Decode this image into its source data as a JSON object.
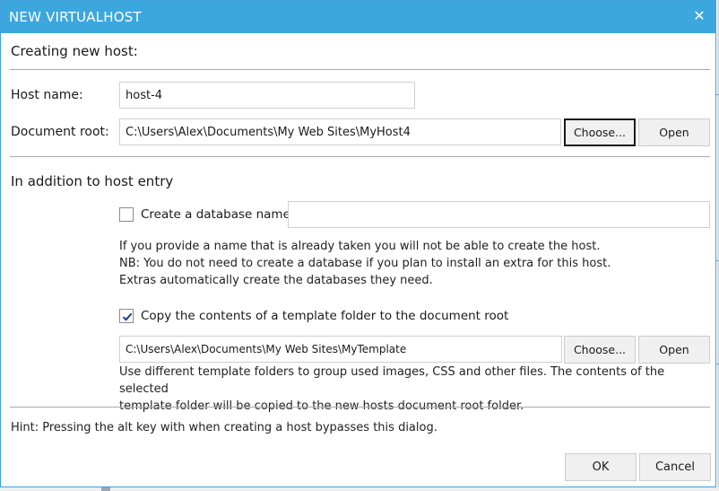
{
  "window": {
    "title": "NEW VIRTUALHOST",
    "close_glyph": "✕"
  },
  "section_header": "Creating new host:",
  "host_name": {
    "label": "Host name:",
    "value": "host-4"
  },
  "document_root": {
    "label": "Document root:",
    "value": "C:\\Users\\Alex\\Documents\\My Web Sites\\MyHost4",
    "choose_label": "Choose...",
    "open_label": "Open"
  },
  "addition": {
    "heading": "In addition to host entry",
    "database": {
      "checked": false,
      "label": "Create a database named:",
      "value": ""
    },
    "database_help": [
      "If you provide a name that is already taken you will not be able to create the host.",
      "NB: You do not need to create a database if you plan to install an extra for this host.",
      "Extras automatically create the databases they need."
    ],
    "template": {
      "checked": true,
      "label": "Copy the contents of a template folder to the document root",
      "path": "C:\\Users\\Alex\\Documents\\My Web Sites\\MyTemplate",
      "choose_label": "Choose...",
      "open_label": "Open"
    },
    "template_help": [
      "Use different template folders to group used images, CSS and other files. The contents of the selected",
      "template folder will be copied to the new hosts document root folder."
    ]
  },
  "hint": "Hint: Pressing the alt key with when creating a host bypasses this dialog.",
  "footer": {
    "ok_label": "OK",
    "cancel_label": "Cancel"
  },
  "colors": {
    "titlebar": "#3ca7dd",
    "checkmark": "#1a3a8c"
  }
}
